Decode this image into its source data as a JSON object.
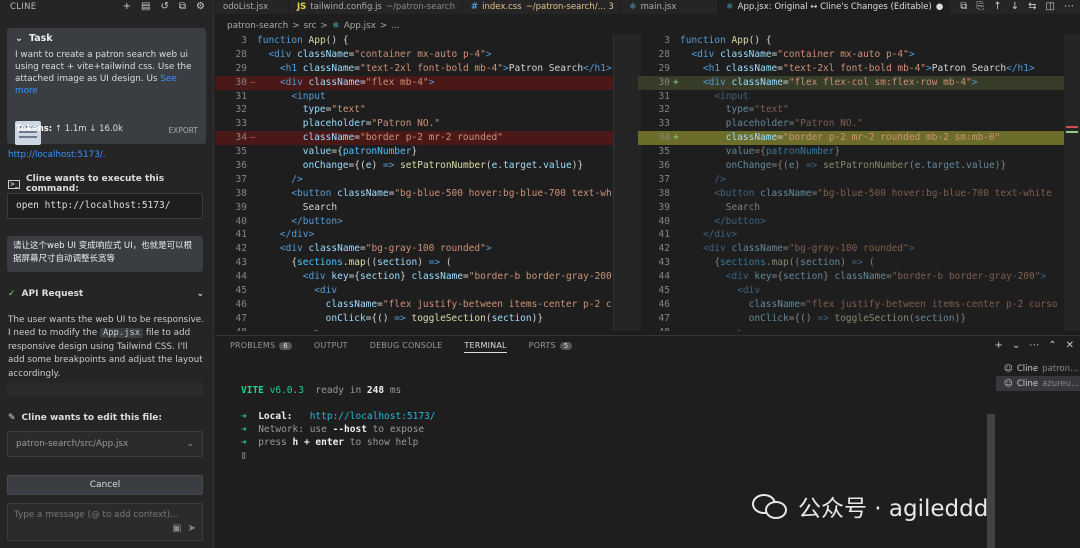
{
  "sidebar": {
    "title": "CLINE",
    "task": {
      "label": "Task",
      "text": "I want to create a patron search web ui using react + vite+tailwind css. Use the attached image as UI design. Us",
      "see_more": "See more",
      "tokens_label": "Tokens:",
      "tokens_up": "1.1m",
      "tokens_down": "16.0k",
      "export": "EXPORT"
    },
    "link": "http://localhost:5173/.",
    "execute_title": "Cline wants to execute this command:",
    "command": "open http://localhost:5173/",
    "user_msg": "请让这个web UI 变成响应式 UI，也就是可以根据屏幕尺寸自动调整长宽等",
    "api_title": "API Request",
    "api_text_1": "The user wants the web UI to be responsive. I need to modify the ",
    "api_file": "App.jsx",
    "api_text_2": " file to add responsive design using Tailwind CSS. I'll add some breakpoints and adjust the layout accordingly.",
    "edit_title": "Cline wants to edit this file:",
    "edit_file": "patron-search/src/App.jsx",
    "cancel": "Cancel",
    "chat_placeholder": "Type a message (@ to add context)..."
  },
  "tabs": [
    {
      "icon": "",
      "label": "odoList.jsx",
      "dim": ""
    },
    {
      "icon": "JS",
      "label": "tailwind.config.js",
      "dim": "~/patron-search"
    },
    {
      "icon": "#",
      "label": "index.css",
      "dim": "~/patron-search/... 3"
    },
    {
      "icon": "",
      "label": "main.jsx",
      "dim": ""
    },
    {
      "icon": "",
      "label": "App.jsx: Original ↔ Cline's Changes (Editable)",
      "dim": "●"
    }
  ],
  "breadcrumb": [
    "patron-search",
    ">",
    "src",
    ">",
    "App.jsx",
    ">",
    "..."
  ],
  "panel": {
    "tabs": [
      {
        "label": "PROBLEMS",
        "badge": "6"
      },
      {
        "label": "OUTPUT",
        "badge": ""
      },
      {
        "label": "DEBUG CONSOLE",
        "badge": ""
      },
      {
        "label": "TERMINAL",
        "badge": ""
      },
      {
        "label": "PORTS",
        "badge": "5"
      }
    ],
    "terminals": [
      {
        "name": "Cline",
        "detail": "patron..."
      },
      {
        "name": "Cline",
        "detail": "azureu..."
      }
    ]
  },
  "terminal": {
    "vite": "VITE",
    "version": "v6.0.3",
    "ready": "ready in",
    "ms": "248",
    "ms_unit": "ms",
    "local_label": "Local:",
    "local_url": "http://localhost:5173/",
    "net_label": "Network:",
    "net_text": "use",
    "net_flag": "--host",
    "net_rest": "to expose",
    "help_a": "press",
    "help_h": "h + enter",
    "help_b": "to show help"
  },
  "watermark": "公众号 · agileddd"
}
